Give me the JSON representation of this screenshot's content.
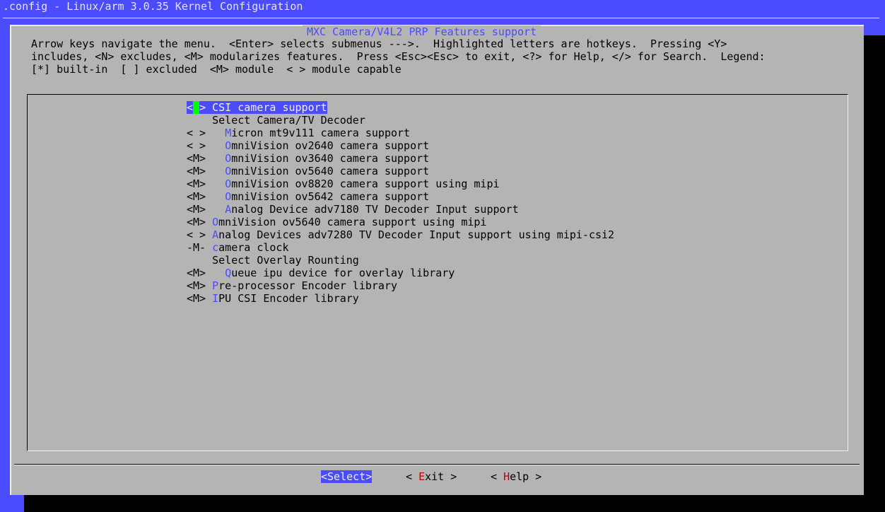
{
  "window": {
    "title": ".config - Linux/arm 3.0.35 Kernel Configuration"
  },
  "dialog": {
    "title": "MXC Camera/V4L2 PRP Features support",
    "help_lines": [
      "Arrow keys navigate the menu.  <Enter> selects submenus --->.  Highlighted letters are hotkeys.  Pressing <Y>",
      "includes, <N> excludes, <M> modularizes features.  Press <Esc><Esc> to exit, <?> for Help, </> for Search.  Legend:",
      "[*] built-in  [ ] excluded  <M> module  < > module capable"
    ]
  },
  "menu": {
    "items": [
      {
        "prefix": "< > ",
        "indent": "",
        "hot": "C",
        "rest": "SI camera support",
        "selected": true
      },
      {
        "prefix": "    ",
        "indent": "",
        "hot": "",
        "rest": "Select Camera/TV Decoder",
        "selected": false
      },
      {
        "prefix": "< > ",
        "indent": "  ",
        "hot": "M",
        "rest": "icron mt9v111 camera support",
        "selected": false
      },
      {
        "prefix": "< > ",
        "indent": "  ",
        "hot": "O",
        "rest": "mniVision ov2640 camera support",
        "selected": false
      },
      {
        "prefix": "<M> ",
        "indent": "  ",
        "hot": "O",
        "rest": "mniVision ov3640 camera support",
        "selected": false
      },
      {
        "prefix": "<M> ",
        "indent": "  ",
        "hot": "O",
        "rest": "mniVision ov5640 camera support",
        "selected": false
      },
      {
        "prefix": "<M> ",
        "indent": "  ",
        "hot": "O",
        "rest": "mniVision ov8820 camera support using mipi",
        "selected": false
      },
      {
        "prefix": "<M> ",
        "indent": "  ",
        "hot": "O",
        "rest": "mniVision ov5642 camera support",
        "selected": false
      },
      {
        "prefix": "<M> ",
        "indent": "  ",
        "hot": "A",
        "rest": "nalog Device adv7180 TV Decoder Input support",
        "selected": false
      },
      {
        "prefix": "<M> ",
        "indent": "",
        "hot": "O",
        "rest": "mniVision ov5640 camera support using mipi",
        "selected": false
      },
      {
        "prefix": "< > ",
        "indent": "",
        "hot": "A",
        "rest": "nalog Devices adv7280 TV Decoder Input support using mipi-csi2",
        "selected": false
      },
      {
        "prefix": "-M- ",
        "indent": "",
        "hot": "c",
        "rest": "amera clock",
        "selected": false
      },
      {
        "prefix": "    ",
        "indent": "",
        "hot": "",
        "rest": "Select Overlay Rounting",
        "selected": false
      },
      {
        "prefix": "<M> ",
        "indent": "  ",
        "hot": "Q",
        "rest": "ueue ipu device for overlay library",
        "selected": false
      },
      {
        "prefix": "<M> ",
        "indent": "",
        "hot": "P",
        "rest": "re-processor Encoder library",
        "selected": false
      },
      {
        "prefix": "<M> ",
        "indent": "",
        "hot": "I",
        "rest": "PU CSI Encoder library",
        "selected": false
      }
    ]
  },
  "buttons": {
    "select": "<Select>",
    "exit": {
      "left": "< ",
      "hot": "E",
      "rest": "xit",
      "right": " >"
    },
    "help": {
      "left": "< ",
      "hot": "H",
      "rest": "elp",
      "right": " >"
    }
  },
  "colors": {
    "background": "#4b4bff",
    "dialog": "#b4b4b4",
    "highlight": "#4b4bff",
    "cursor": "#00ff00",
    "hotkey_button": "#c00000"
  }
}
